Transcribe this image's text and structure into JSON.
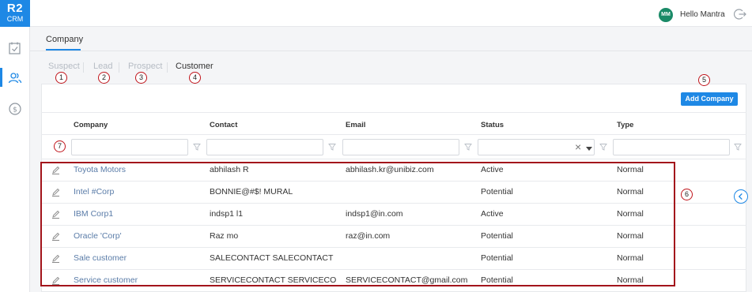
{
  "app": {
    "logo_line1": "R2",
    "logo_line2": "CRM"
  },
  "sidebar": {
    "items": [
      {
        "name": "tasks",
        "icon": "checklist-icon"
      },
      {
        "name": "contacts",
        "icon": "users-icon",
        "active": true
      },
      {
        "name": "finance",
        "icon": "dollar-icon"
      }
    ]
  },
  "header": {
    "avatar_initials": "MM",
    "greeting": "Hello Mantra",
    "logout_icon": "logout-icon"
  },
  "page": {
    "title": "Company"
  },
  "tabs": [
    {
      "label": "Suspect",
      "active": false
    },
    {
      "label": "Lead",
      "active": false
    },
    {
      "label": "Prospect",
      "active": false
    },
    {
      "label": "Customer",
      "active": true
    }
  ],
  "markers": [
    "1",
    "2",
    "3",
    "4",
    "5",
    "6",
    "7"
  ],
  "toolbar": {
    "add_label": "Add Company"
  },
  "table": {
    "columns": [
      "Company",
      "Contact",
      "Email",
      "Status",
      "Type"
    ],
    "status_filter_clear": "×",
    "rows": [
      {
        "company": "Toyota Motors",
        "contact": "abhilash R",
        "email": "abhilash.kr@unibiz.com",
        "status": "Active",
        "type": "Normal"
      },
      {
        "company": "Intel #Corp",
        "contact": "BONNIE@#$! MURAL",
        "email": "",
        "status": "Potential",
        "type": "Normal"
      },
      {
        "company": "IBM Corp1",
        "contact": "indsp1 l1",
        "email": "indsp1@in.com",
        "status": "Active",
        "type": "Normal"
      },
      {
        "company": "Oracle 'Corp'",
        "contact": "Raz mo",
        "email": "raz@in.com",
        "status": "Potential",
        "type": "Normal"
      },
      {
        "company": "Sale customer",
        "contact": "SALECONTACT SALECONTACT",
        "email": "",
        "status": "Potential",
        "type": "Normal"
      },
      {
        "company": "Service customer",
        "contact": "SERVICECONTACT SERVICECONT...",
        "email": "SERVICECONTACT@gmail.com",
        "status": "Potential",
        "type": "Normal"
      }
    ]
  },
  "colors": {
    "accent": "#1e88e5",
    "avatar": "#1a8a67",
    "annotation": "#a3141b",
    "link": "#5a7ca8"
  }
}
